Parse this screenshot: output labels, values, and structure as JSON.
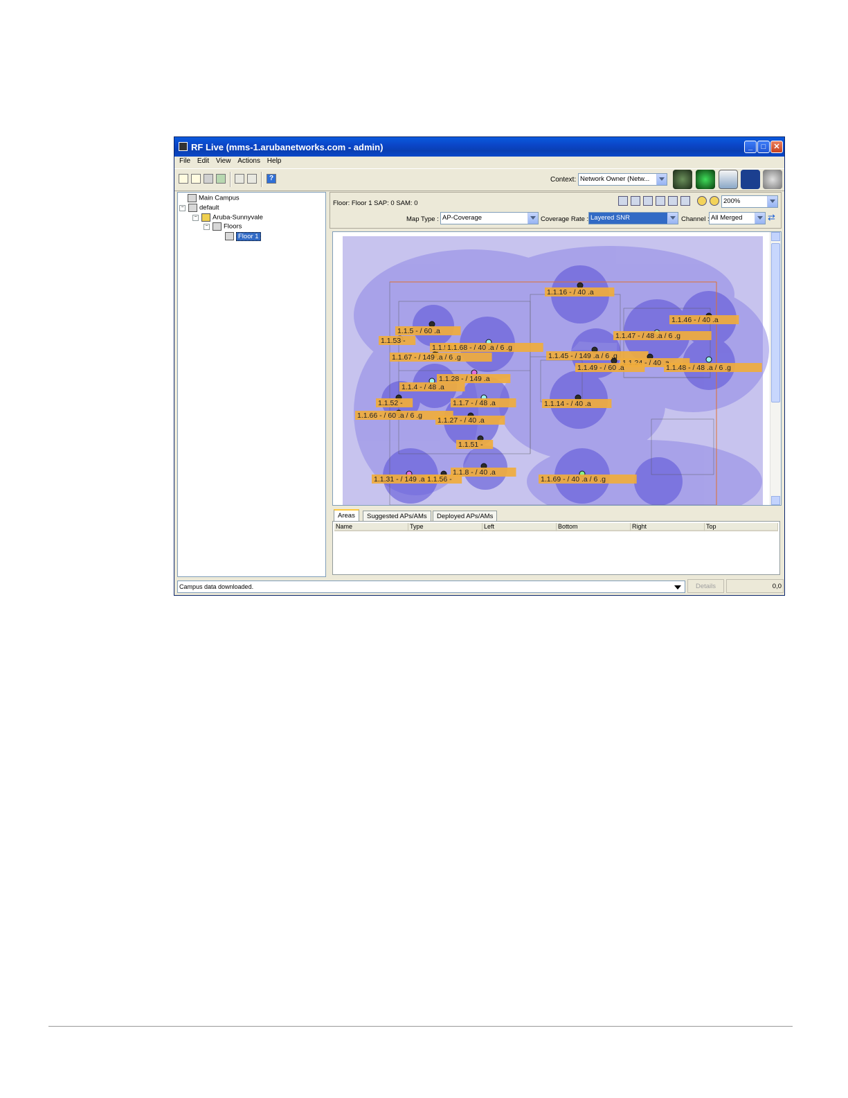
{
  "window": {
    "title": "RF Live (mms-1.arubanetworks.com - admin)",
    "controls": [
      "minimize",
      "maximize",
      "close"
    ]
  },
  "menu": [
    "File",
    "Edit",
    "View",
    "Actions",
    "Help"
  ],
  "toolbar": {
    "context_label": "Context:",
    "context_value": "Network Owner (Netw..."
  },
  "tree": {
    "nodes": [
      {
        "label": "Main Campus",
        "icon": "campus-icon"
      },
      {
        "label": "default",
        "icon": "campus-icon"
      },
      {
        "label": "Aruba-Sunnyvale",
        "icon": "building-icon"
      },
      {
        "label": "Floors",
        "icon": "floors-icon"
      },
      {
        "label": "Floor 1",
        "icon": "floor-icon",
        "selected": true
      }
    ]
  },
  "map_header": {
    "floor_info": "Floor: Floor 1   SAP: 0   SAM: 0",
    "zoom": "200%",
    "map_type_label": "Map Type :",
    "map_type_value": "AP-Coverage",
    "coverage_rate_label": "Coverage Rate :",
    "coverage_rate_value": "Layered SNR",
    "channel_label": "Channel :",
    "channel_value": "All Merged"
  },
  "map": {
    "ap_labels": [
      "1.1.16 - / 40 .a",
      "1.1.46 - / 40 .a",
      "1.1.5 - / 60 .a",
      "1.1.53 -",
      "1.1.47 - / 48 .a / 6 .g",
      "1.1.50",
      "1.1.68 - / 40 .a / 6 .g",
      "1.1.67 - / 149 .a / 6 .g",
      "1.1.45 - / 149 .a / 6 .g",
      "1.1.24 - / 40 .a",
      "1.1.49 - / 60 .a",
      "1.1.48 - / 48 .a / 6 .g",
      "1.1.28 - / 149 .a",
      "1.1.4 - / 48 .a",
      "1.1.52 -",
      "1.1.7 - / 48 .a",
      "1.1.14 - / 40 .a",
      "1.1.66 - / 60 .a / 6 .g",
      "1.1.27 - / 40 .a",
      "1.1.51 -",
      "1.1.8 - / 40 .a",
      "1.1.31 - / 149 .a",
      "1.1.56 -",
      "1.1.69 - / 40 .a / 6 .g"
    ]
  },
  "bottom_tabs": [
    "Areas",
    "Suggested APs/AMs",
    "Deployed APs/AMs"
  ],
  "areas_table": {
    "columns": [
      "Name",
      "Type",
      "Left",
      "Bottom",
      "Right",
      "Top"
    ],
    "rows": []
  },
  "status": {
    "message": "Campus data downloaded.",
    "details_label": "Details",
    "coordinates": "0,0"
  }
}
